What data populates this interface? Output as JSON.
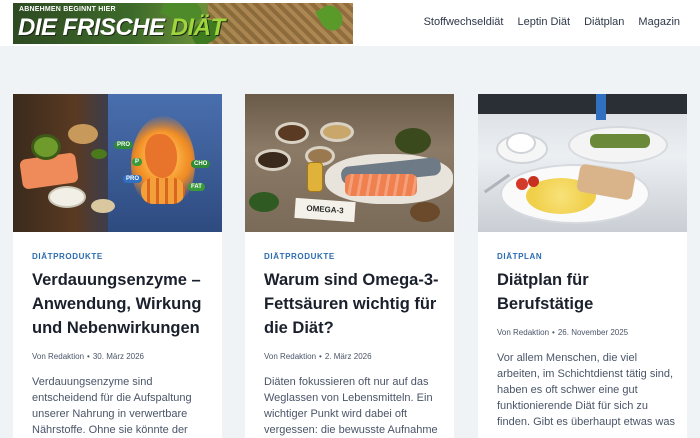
{
  "header": {
    "logo_small": "ABNEHMEN BEGINNT HIER",
    "logo_big_a": "DIE FRISCHE ",
    "logo_big_b": "DIÄT",
    "nav": [
      "Stoffwechseldiät",
      "Leptin Diät",
      "Diätplan",
      "Magazin"
    ]
  },
  "posts": [
    {
      "category": "DIÄTPRODUKTE",
      "title": "Verdauungsenzyme – Anwendung, Wirkung und Nebenwirkungen",
      "author": "Von Redaktion",
      "date": "30. März 2026",
      "excerpt": "Verdauungsenzyme sind entscheidend für die Aufspaltung unserer Nahrung in verwertbare Nährstoffe. Ohne sie könnte der Körper keine Energie aus",
      "image_icon": "digestive-system-illustration"
    },
    {
      "category": "DIÄTPRODUKTE",
      "title": "Warum sind Omega-3-Fettsäuren wichtig für die Diät?",
      "author": "Von Redaktion",
      "date": "2. März 2026",
      "excerpt": "Diäten fokussieren oft nur auf das Weglassen von Lebensmitteln. Ein wichtiger Punkt wird dabei oft vergessen: die bewusste Aufnahme",
      "image_label": "OMEGA-3"
    },
    {
      "category": "DIÄTPLAN",
      "title": "Diätplan für Berufstätige",
      "author": "Von Redaktion",
      "date": "26. November 2025",
      "excerpt": "Vor allem Menschen, die viel arbeiten, im Schichtdienst tätig sind, haben es oft schwer eine gut funktionierende Diät für sich zu finden. Gibt es überhaupt etwas was",
      "image_icon": "breakfast-plate-photo"
    }
  ],
  "img1_badges": [
    "PRO",
    "P",
    "PRO",
    "CHO",
    "FAT"
  ],
  "colors": {
    "accent": "#2b6cb0",
    "background": "#f0f3f6"
  }
}
